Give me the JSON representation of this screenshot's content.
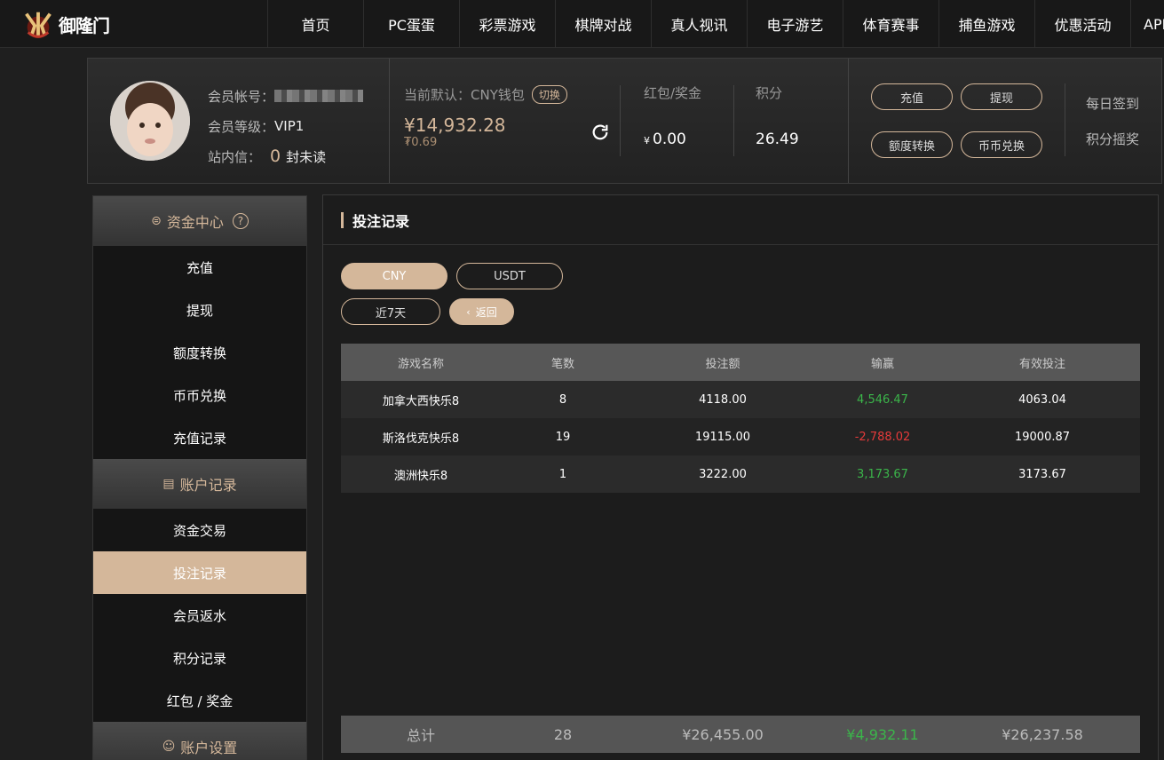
{
  "brand": {
    "name": "御隆门"
  },
  "nav": [
    "首页",
    "PC蛋蛋",
    "彩票游戏",
    "棋牌对战",
    "真人视讯",
    "电子游艺",
    "体育赛事",
    "捕鱼游戏",
    "优惠活动",
    "APP"
  ],
  "user": {
    "account_label": "会员帐号：",
    "level_label": "会员等级：",
    "level_value": "VIP1",
    "msg_label": "站内信：",
    "msg_count": "0",
    "msg_suffix": "封未读"
  },
  "wallet": {
    "label": "当前默认：CNY钱包",
    "switch": "切换",
    "balance": "¥14,932.28",
    "balance2": "₮0.69"
  },
  "bonus": {
    "label": "红包/奖金",
    "currency": "¥",
    "value": "0.00"
  },
  "points": {
    "label": "积分",
    "value": "26.49"
  },
  "actions": {
    "deposit": "充值",
    "withdraw": "提现",
    "transfer": "额度转换",
    "exchange": "币币兑换",
    "checkin": "每日签到",
    "lottery": "积分摇奖"
  },
  "sidebar": {
    "fund_center": "资金中心",
    "fund_items": [
      "充值",
      "提现",
      "额度转换",
      "币币兑换",
      "充值记录"
    ],
    "account_records": "账户记录",
    "record_items": [
      "资金交易",
      "投注记录",
      "会员返水",
      "积分记录",
      "红包 / 奖金"
    ],
    "account_settings": "账户设置"
  },
  "main": {
    "title": "投注记录",
    "currency_tabs": [
      "CNY",
      "USDT"
    ],
    "period": "近7天",
    "back": "返回",
    "headers": [
      "游戏名称",
      "笔数",
      "投注额",
      "输赢",
      "有效投注"
    ],
    "rows": [
      {
        "name": "加拿大西快乐8",
        "count": "8",
        "bet": "4118.00",
        "win": "4,546.47",
        "valid": "4063.04"
      },
      {
        "name": "斯洛伐克快乐8",
        "count": "19",
        "bet": "19115.00",
        "win": "-2,788.02",
        "valid": "19000.87"
      },
      {
        "name": "澳洲快乐8",
        "count": "1",
        "bet": "3222.00",
        "win": "3,173.67",
        "valid": "3173.67"
      }
    ],
    "total": {
      "label": "总计",
      "count": "28",
      "bet": "¥26,455.00",
      "win": "¥4,932.11",
      "valid": "¥26,237.58"
    }
  },
  "colors": {
    "accent": "#d4b79a",
    "positive": "#3bb54a",
    "negative": "#e53a3a"
  }
}
